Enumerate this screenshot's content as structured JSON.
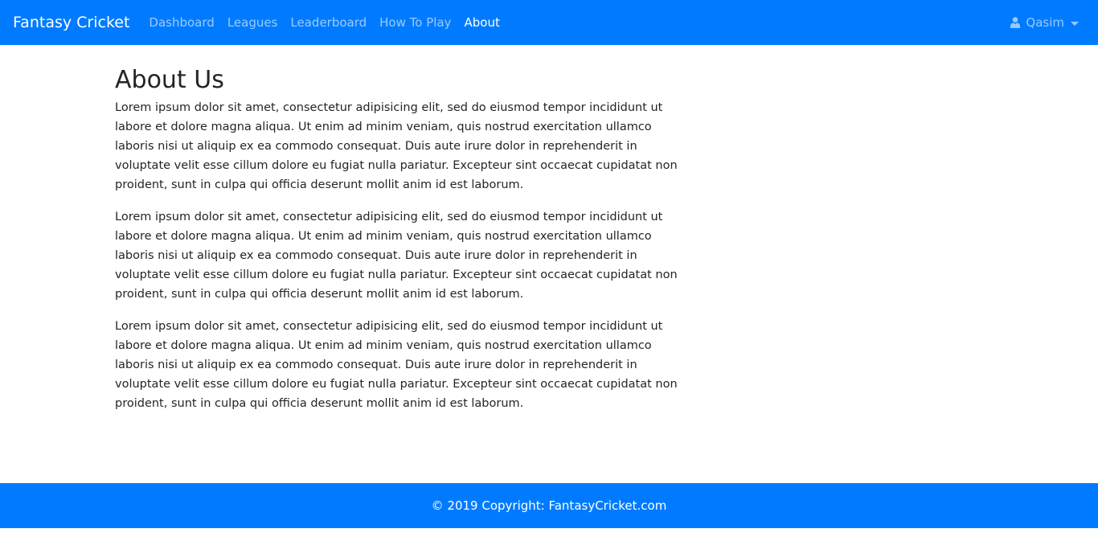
{
  "navbar": {
    "brand": "Fantasy Cricket",
    "links": [
      {
        "label": "Dashboard",
        "active": false
      },
      {
        "label": "Leagues",
        "active": false
      },
      {
        "label": "Leaderboard",
        "active": false
      },
      {
        "label": "How To Play",
        "active": false
      },
      {
        "label": "About",
        "active": true
      }
    ],
    "user": {
      "name": "Qasim",
      "icon": "user-icon"
    }
  },
  "main": {
    "title": "About Us",
    "paragraphs": [
      "Lorem ipsum dolor sit amet, consectetur adipisicing elit, sed do eiusmod tempor incididunt ut labore et dolore magna aliqua. Ut enim ad minim veniam, quis nostrud exercitation ullamco laboris nisi ut aliquip ex ea commodo consequat. Duis aute irure dolor in reprehenderit in voluptate velit esse cillum dolore eu fugiat nulla pariatur. Excepteur sint occaecat cupidatat non proident, sunt in culpa qui officia deserunt mollit anim id est laborum.",
      "Lorem ipsum dolor sit amet, consectetur adipisicing elit, sed do eiusmod tempor incididunt ut labore et dolore magna aliqua. Ut enim ad minim veniam, quis nostrud exercitation ullamco laboris nisi ut aliquip ex ea commodo consequat. Duis aute irure dolor in reprehenderit in voluptate velit esse cillum dolore eu fugiat nulla pariatur. Excepteur sint occaecat cupidatat non proident, sunt in culpa qui officia deserunt mollit anim id est laborum.",
      "Lorem ipsum dolor sit amet, consectetur adipisicing elit, sed do eiusmod tempor incididunt ut labore et dolore magna aliqua. Ut enim ad minim veniam, quis nostrud exercitation ullamco laboris nisi ut aliquip ex ea commodo consequat. Duis aute irure dolor in reprehenderit in voluptate velit esse cillum dolore eu fugiat nulla pariatur. Excepteur sint occaecat cupidatat non proident, sunt in culpa qui officia deserunt mollit anim id est laborum."
    ]
  },
  "footer": {
    "text": "© 2019 Copyright: FantasyCricket.com"
  },
  "colors": {
    "primary": "#007bff",
    "text": "#212529"
  }
}
